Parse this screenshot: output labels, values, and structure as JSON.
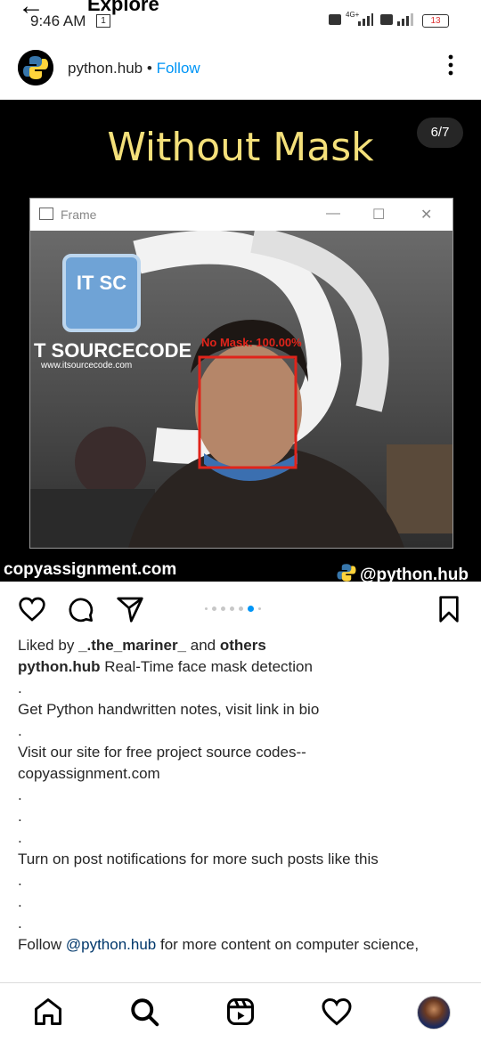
{
  "status_bar": {
    "back_glyph": "←",
    "screen_title": "Explore",
    "time": "9:46 AM",
    "note_icon": "1",
    "sim1": "4G+",
    "battery": "13"
  },
  "header": {
    "username": "python.hub",
    "separator": "•",
    "follow_label": "Follow",
    "more_glyph": "⋮"
  },
  "post": {
    "title": "Without Mask",
    "counter": "6/7",
    "window_title": "Frame",
    "detection_label": "No Mask: 100.00%",
    "watermark_brand": "T SOURCECODE",
    "watermark_logo": "IT SC",
    "watermark_url": "www.itsourcecode.com",
    "footer_left": "copyassignment.com",
    "footer_right": "@python.hub"
  },
  "carousel": {
    "total": 7,
    "active": 6
  },
  "caption": {
    "liked_prefix": "Liked by",
    "liked_user": "_.the_mariner_",
    "liked_and": "and",
    "liked_others": "others",
    "author": "python.hub",
    "text": "Real-Time face mask detection",
    "dot": ".",
    "line_notes": "Get Python handwritten notes, visit link in bio",
    "line_site_1": "Visit our site for free project source codes--",
    "line_site_2": "copyassignment.com",
    "line_notify": "Turn on post notifications for more such posts like this",
    "line_follow_prefix": "Follow",
    "line_follow_mention": "@python.hub",
    "line_follow_suffix": "for more content on computer science,"
  },
  "icons": {
    "like": "heart-icon",
    "comment": "comment-icon",
    "share": "send-icon",
    "save": "bookmark-icon",
    "home": "home-icon",
    "search": "search-icon",
    "reels": "reels-icon",
    "activity": "heart-icon",
    "profile": "avatar"
  },
  "colors": {
    "follow": "#0095f6",
    "title": "#f4e07a",
    "detection_box": "#e0241b",
    "dot_active": "#0095f6"
  }
}
